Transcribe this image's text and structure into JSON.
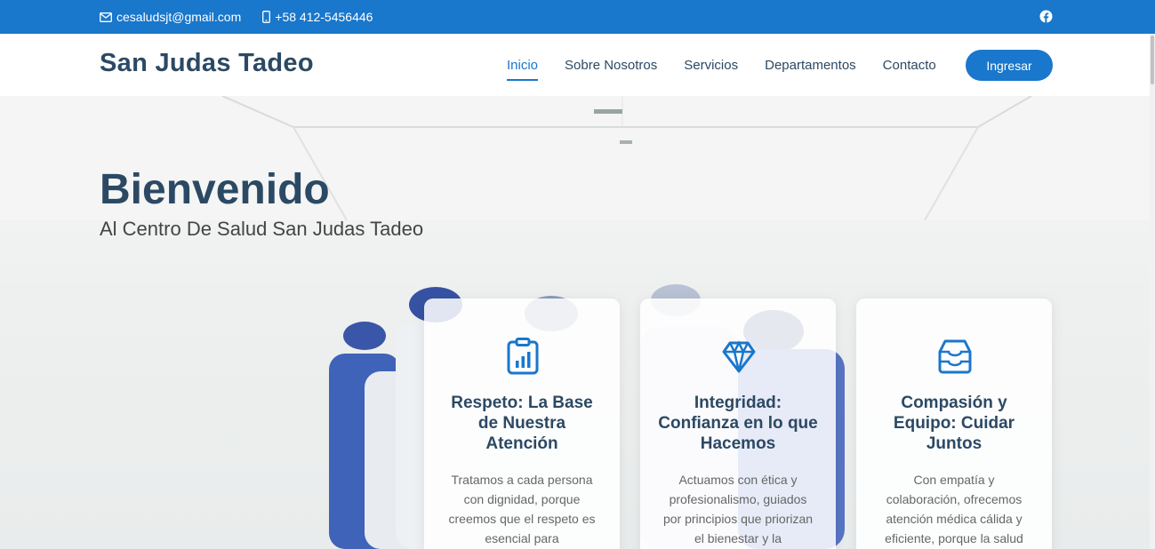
{
  "topbar": {
    "email": "cesaludsjt@gmail.com",
    "phone": "+58 412-5456446",
    "social_icon": "facebook-icon"
  },
  "header": {
    "logo": "San Judas Tadeo",
    "nav": [
      "Inicio",
      "Sobre Nosotros",
      "Servicios",
      "Departamentos",
      "Contacto"
    ],
    "active_nav": "Inicio",
    "login_label": "Ingresar"
  },
  "hero": {
    "title": "Bienvenido",
    "subtitle": "Al Centro De Salud San Judas Tadeo"
  },
  "cards": [
    {
      "icon": "clipboard-chart-icon",
      "title": "Respeto: La Base de Nuestra Atención",
      "text": "Tratamos a cada persona con dignidad, porque creemos que el respeto es esencial para"
    },
    {
      "icon": "gem-icon",
      "title": "Integridad: Confianza en lo que Hacemos",
      "text": "Actuamos con ética y profesionalismo, guiados por principios que priorizan el bienestar y la"
    },
    {
      "icon": "inbox-stack-icon",
      "title": "Compasión y Equipo: Cuidar Juntos",
      "text": "Con empatía y colaboración, ofrecemos atención médica cálida y eficiente, porque la salud"
    }
  ],
  "colors": {
    "brand": "#1977cc",
    "heading": "#2c4964"
  }
}
